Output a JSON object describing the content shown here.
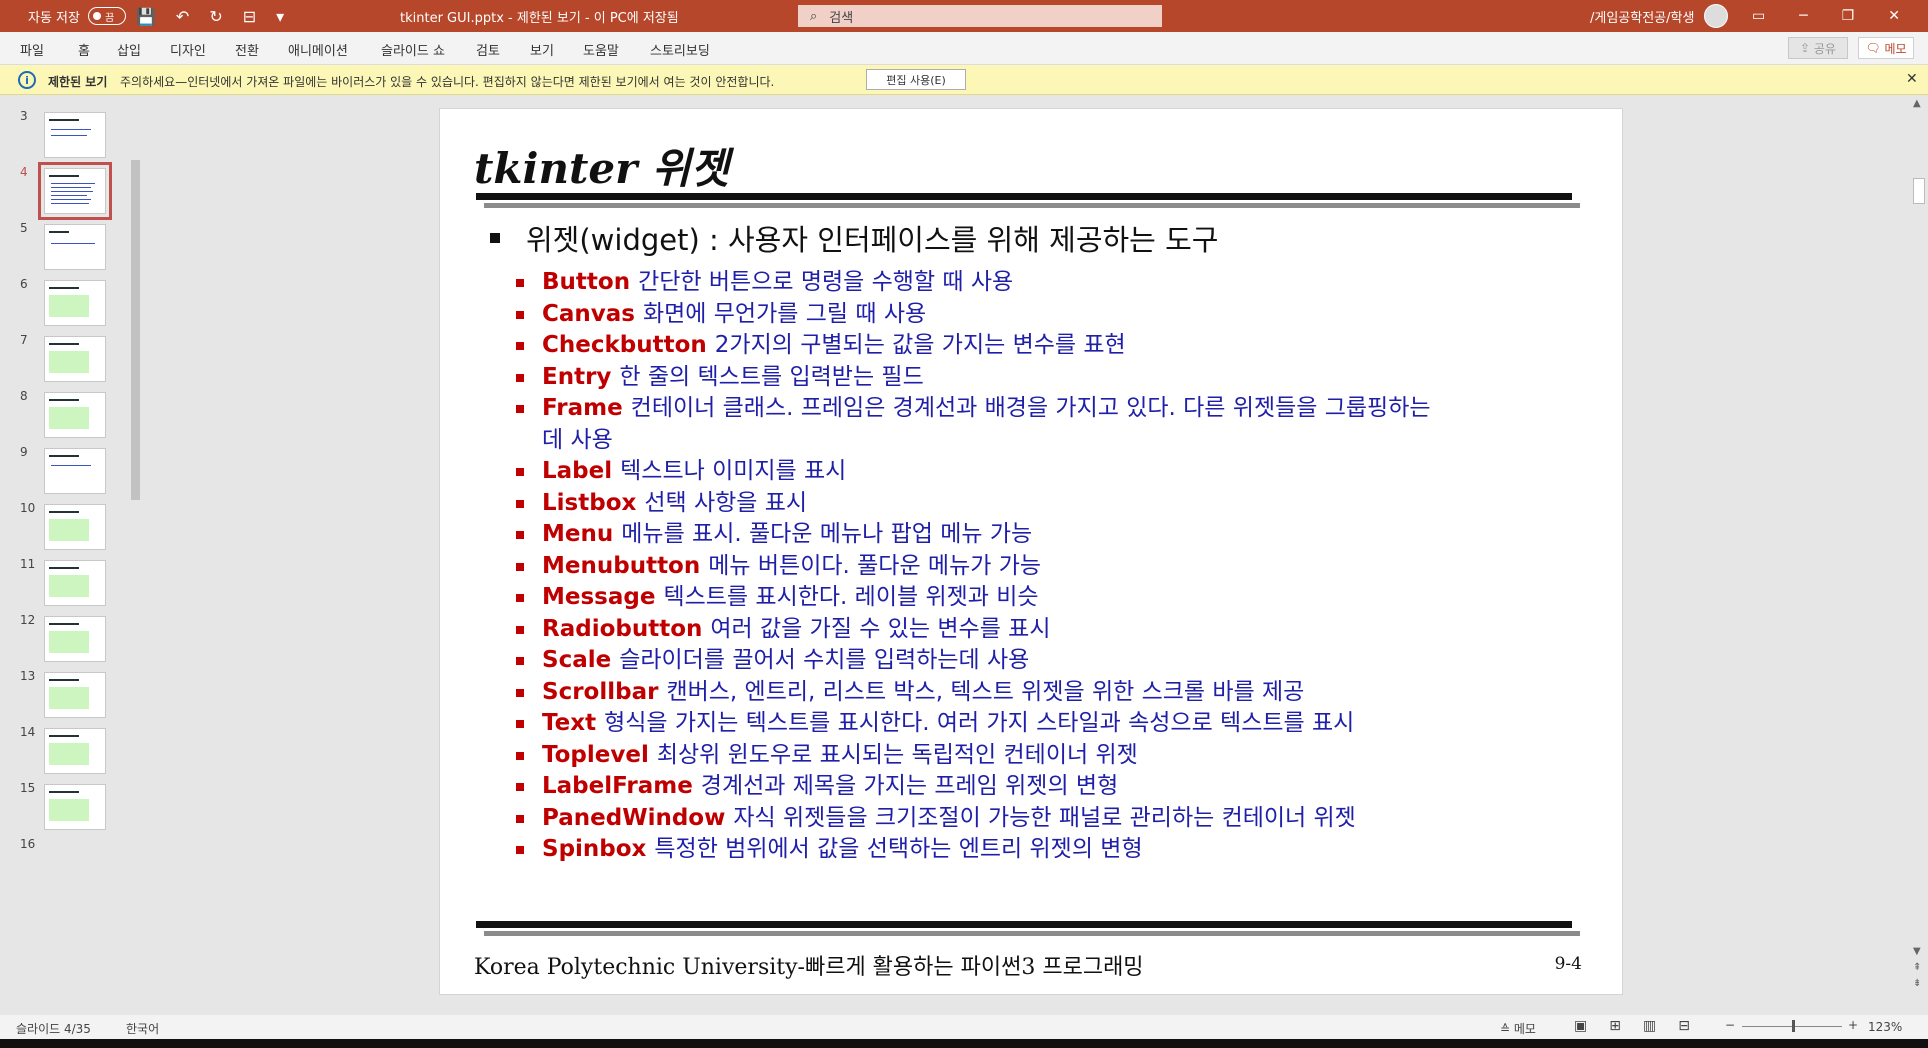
{
  "titlebar": {
    "autosave_label": "자동 저장",
    "autosave_state": "끔",
    "doc_title": "tkinter GUI.pptx  -  제한된 보기  -  이 PC에 저장됨",
    "search_placeholder": "검색",
    "user": "/게임공학전공/학생",
    "accent_color": "#b7472a"
  },
  "menu": {
    "items": [
      "파일",
      "홈",
      "삽입",
      "디자인",
      "전환",
      "애니메이션",
      "슬라이드 쇼",
      "검토",
      "보기",
      "도움말",
      "스토리보딩"
    ],
    "share_label": "공유",
    "memo_label": "메모"
  },
  "protected_view": {
    "title": "제한된 보기",
    "message": "주의하세요—인터넷에서 가져온 파일에는 바이러스가 있을 수 있습니다. 편집하지 않는다면 제한된 보기에서 여는 것이 안전합니다.",
    "button": "편집 사용(E)"
  },
  "thumbnails": {
    "numbers": [
      "3",
      "4",
      "5",
      "6",
      "7",
      "8",
      "9",
      "10",
      "11",
      "12",
      "13",
      "14",
      "15",
      "16"
    ],
    "active": "4"
  },
  "slide": {
    "title": "tkinter 위젯",
    "main_bullet": "위젯(widget) : 사용자 인터페이스를 위해 제공하는 도구",
    "items": [
      {
        "k": "Button",
        "d": "간단한 버튼으로 명령을 수행할 때 사용"
      },
      {
        "k": "Canvas",
        "d": "화면에 무언가를 그릴 때 사용"
      },
      {
        "k": "Checkbutton",
        "d": "2가지의 구별되는 값을 가지는 변수를 표현"
      },
      {
        "k": "Entry",
        "d": "한 줄의 텍스트를 입력받는 필드"
      },
      {
        "k": "Frame",
        "d": "컨테이너 클래스. 프레임은 경계선과 배경을 가지고 있다. 다른 위젯들을 그룹핑하는데 사용"
      },
      {
        "k": "Label",
        "d": "텍스트나 이미지를 표시"
      },
      {
        "k": "Listbox",
        "d": "선택 사항을 표시"
      },
      {
        "k": "Menu",
        "d": "메뉴를 표시. 풀다운 메뉴나 팝업 메뉴 가능"
      },
      {
        "k": "Menubutton",
        "d": "메뉴 버튼이다. 풀다운 메뉴가 가능"
      },
      {
        "k": "Message",
        "d": "텍스트를 표시한다. 레이블 위젯과 비슷"
      },
      {
        "k": "Radiobutton",
        "d": "여러 값을 가질 수 있는 변수를 표시"
      },
      {
        "k": "Scale",
        "d": "슬라이더를 끌어서 수치를 입력하는데 사용"
      },
      {
        "k": "Scrollbar",
        "d": "캔버스, 엔트리, 리스트 박스, 텍스트 위젯을 위한 스크롤 바를 제공"
      },
      {
        "k": "Text",
        "d": "형식을 가지는 텍스트를 표시한다. 여러 가지 스타일과 속성으로 텍스트를 표시"
      },
      {
        "k": "Toplevel",
        "d": "최상위 윈도우로 표시되는 독립적인 컨테이너 위젯"
      },
      {
        "k": "LabelFrame",
        "d": "경계선과 제목을 가지는 프레임 위젯의 변형"
      },
      {
        "k": "PanedWindow",
        "d": "자식 위젯들을 크기조절이 가능한 패널로 관리하는 컨테이너 위젯"
      },
      {
        "k": "Spinbox",
        "d": "특정한 범위에서 값을 선택하는 엔트리 위젯의 변형"
      }
    ],
    "footer_left": "Korea Polytechnic University-빠르게 활용하는 파이썬3 프로그래밍",
    "footer_right": "9-4",
    "keyword_color": "#c00000",
    "desc_color": "#1f1fa8"
  },
  "status": {
    "slide_info": "슬라이드 4/35",
    "language": "한국어",
    "notes": "메모",
    "zoom_minus": "−",
    "zoom_plus": "+",
    "zoom": "123%"
  }
}
